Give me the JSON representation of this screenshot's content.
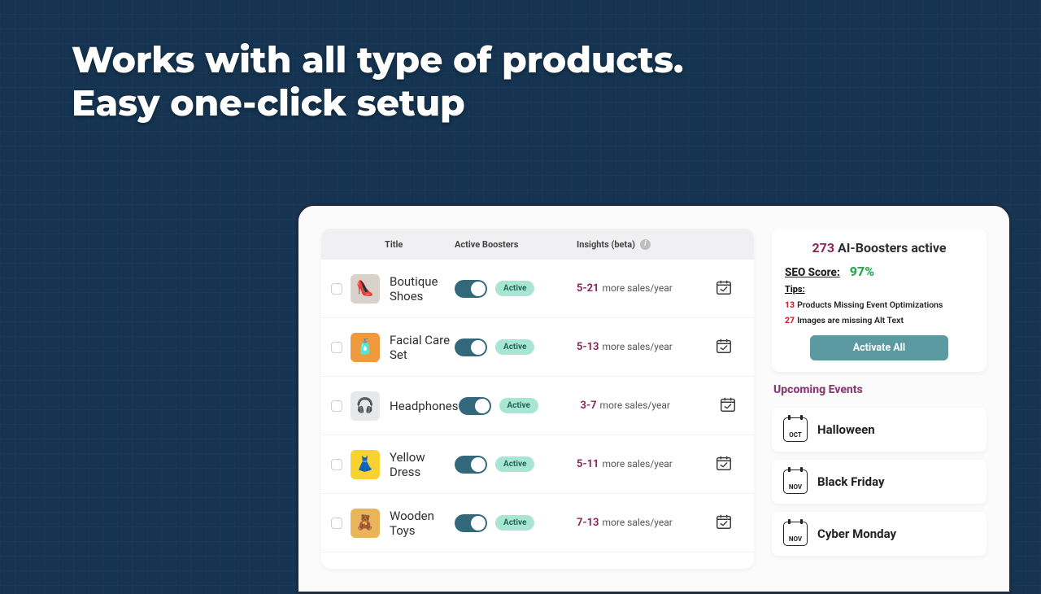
{
  "hero": {
    "line1": "Works with all type of products.",
    "line2": "Easy one-click setup"
  },
  "columns": {
    "title": "Title",
    "active_boosters": "Active Boosters",
    "insights": "Insights (beta)"
  },
  "products": [
    {
      "name": "Boutique Shoes",
      "status": "Active",
      "range": "5-21",
      "suffix": "more sales/year",
      "thumb_bg": "#d9d2cb",
      "thumb_emoji": "👠"
    },
    {
      "name": "Facial Care Set",
      "status": "Active",
      "range": "5-13",
      "suffix": "more sales/year",
      "thumb_bg": "#ef9a3d",
      "thumb_emoji": "🧴"
    },
    {
      "name": "Headphones",
      "status": "Active",
      "range": "3-7",
      "suffix": "more sales/year",
      "thumb_bg": "#e6e8ea",
      "thumb_emoji": "🎧"
    },
    {
      "name": "Yellow Dress",
      "status": "Active",
      "range": "5-11",
      "suffix": "more sales/year",
      "thumb_bg": "#f7d230",
      "thumb_emoji": "👗"
    },
    {
      "name": "Wooden Toys",
      "status": "Active",
      "range": "7-13",
      "suffix": "more sales/year",
      "thumb_bg": "#e8b55a",
      "thumb_emoji": "🧸"
    }
  ],
  "sidebar": {
    "boosters_count": "273",
    "boosters_label": "AI-Boosters active",
    "seo_label": "SEO Score:",
    "seo_value": "97%",
    "tips_label": "Tips:",
    "tips": [
      {
        "n": "13",
        "text": "Products Missing Event Optimizations"
      },
      {
        "n": "27",
        "text": "Images are missing Alt Text"
      }
    ],
    "activate_label": "Activate All",
    "events_title": "Upcoming Events",
    "events": [
      {
        "month": "OCT",
        "name": "Halloween"
      },
      {
        "month": "NOV",
        "name": "Black Friday"
      },
      {
        "month": "NOV",
        "name": "Cyber Monday"
      }
    ]
  }
}
